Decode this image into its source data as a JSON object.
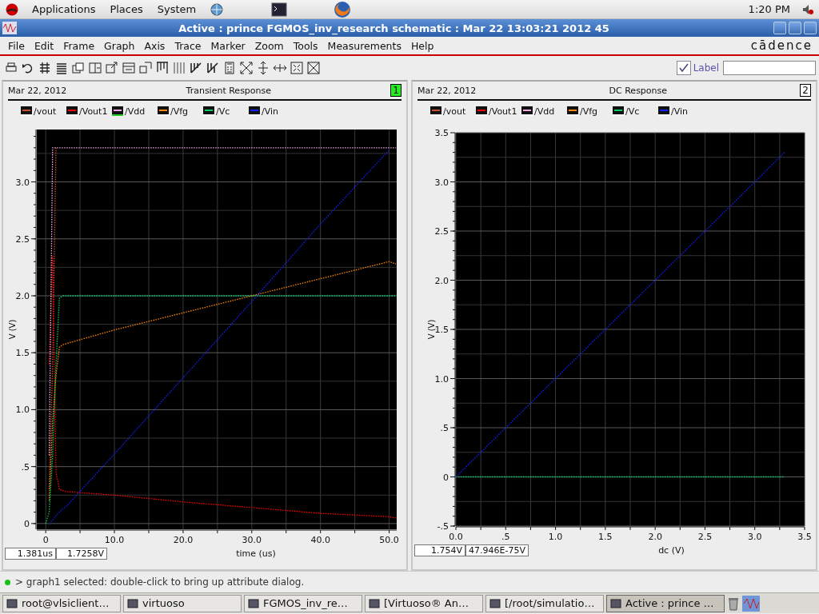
{
  "top_panel": {
    "menus": [
      "Applications",
      "Places",
      "System"
    ],
    "clock": "1:20 PM"
  },
  "window": {
    "title": "Active : prince FGMOS_inv_research schematic : Mar 22 13:03:21 2012 45",
    "menu": [
      "File",
      "Edit",
      "Frame",
      "Graph",
      "Axis",
      "Trace",
      "Marker",
      "Zoom",
      "Tools",
      "Measurements",
      "Help"
    ],
    "logo": "cādence"
  },
  "toolbar": {
    "label_checkbox": {
      "label": "Label",
      "checked": true
    }
  },
  "graphs": [
    {
      "date": "Mar 22, 2012",
      "title": "Transient Response",
      "number": "1",
      "selected": true,
      "legend": [
        {
          "selected": false
        },
        {
          "selected": false
        },
        {
          "selected": true
        },
        {
          "selected": false
        },
        {
          "selected": false
        },
        {
          "selected": false
        }
      ],
      "chart_data": {
        "type": "line",
        "grid": true,
        "xlabel": "time (us)",
        "ylabel": "V (V)",
        "x": [
          0,
          0.5,
          1,
          1.5,
          2,
          2.5,
          3,
          10,
          20,
          30,
          40,
          50,
          51
        ],
        "xlim": [
          -1.3,
          51.1
        ],
        "ylim": [
          -0.05,
          3.46
        ],
        "xticks": [
          {
            "value": 0,
            "label": "0"
          },
          {
            "value": 10,
            "label": "10.0"
          },
          {
            "value": 20,
            "label": "20.0"
          },
          {
            "value": 30,
            "label": "30.0"
          },
          {
            "value": 40,
            "label": "40.0"
          },
          {
            "value": 50,
            "label": "50.0"
          }
        ],
        "yticks": [
          {
            "value": 0,
            "label": "0"
          },
          {
            "value": 0.5,
            "label": ".5"
          },
          {
            "value": 1,
            "label": "1.0"
          },
          {
            "value": 1.5,
            "label": "1.5"
          },
          {
            "value": 2,
            "label": "2.0"
          },
          {
            "value": 2.5,
            "label": "2.5"
          },
          {
            "value": 3,
            "label": "3.0"
          }
        ],
        "series": [
          {
            "name": "/vout",
            "color": "#c8502a",
            "line_style": "dotted",
            "values": [
              null,
              0.3,
              1.4,
              3.3,
              null,
              null,
              null,
              null,
              null,
              null,
              null,
              null,
              null
            ]
          },
          {
            "name": "/Vout1",
            "color": "#ff0000",
            "line_style": "dotted",
            "values": [
              null,
              1.4,
              2.35,
              0.45,
              0.3,
              0.29,
              0.28,
              0.25,
              0.19,
              0.14,
              0.09,
              0.06,
              0.05
            ]
          },
          {
            "name": "/Vdd",
            "color": "#f4a8e8",
            "line_style": "dotted",
            "values": [
              null,
              0.6,
              3.3,
              3.3,
              3.3,
              3.3,
              3.3,
              3.3,
              3.3,
              3.3,
              3.3,
              3.3,
              3.3
            ]
          },
          {
            "name": "/Vfg",
            "color": "#ff8800",
            "line_style": "dotted",
            "values": [
              null,
              0.2,
              0.9,
              1.3,
              1.55,
              1.57,
              1.58,
              1.7,
              1.85,
              2.0,
              2.15,
              2.3,
              2.28
            ]
          },
          {
            "name": "/Vc",
            "color": "#00d060",
            "line_style": "dotted",
            "values": [
              0,
              0.1,
              0.6,
              1.4,
              1.98,
              2.0,
              2.0,
              2.0,
              2.0,
              2.0,
              2.0,
              2.0,
              2.0
            ]
          },
          {
            "name": "/Vin",
            "color": "#1020ff",
            "line_style": "dotted",
            "values": [
              null,
              0,
              0.03,
              0.07,
              0.1,
              0.13,
              0.15,
              0.61,
              1.28,
              1.95,
              2.63,
              3.28,
              null
            ]
          }
        ]
      },
      "readouts": [
        "1.381us",
        "1.7258V"
      ]
    },
    {
      "date": "Mar 22, 2012",
      "title": "DC Response",
      "number": "2",
      "selected": false,
      "legend": [
        {
          "selected": false
        },
        {
          "selected": false
        },
        {
          "selected": false
        },
        {
          "selected": false
        },
        {
          "selected": false
        },
        {
          "selected": false
        }
      ],
      "chart_data": {
        "type": "line",
        "grid": true,
        "xlabel": "dc (V)",
        "ylabel": "V (V)",
        "x": [
          0,
          3.3
        ],
        "xlim": [
          0,
          3.5
        ],
        "ylim": [
          -0.5,
          3.5
        ],
        "xticks": [
          {
            "value": 0,
            "label": "0.0"
          },
          {
            "value": 0.5,
            "label": ".5"
          },
          {
            "value": 1,
            "label": "1.0"
          },
          {
            "value": 1.5,
            "label": "1.5"
          },
          {
            "value": 2,
            "label": "2.0"
          },
          {
            "value": 2.5,
            "label": "2.5"
          },
          {
            "value": 3,
            "label": "3.0"
          },
          {
            "value": 3.5,
            "label": "3.5"
          }
        ],
        "yticks": [
          {
            "value": -0.5,
            "label": "-.5"
          },
          {
            "value": 0,
            "label": "0"
          },
          {
            "value": 0.5,
            "label": ".5"
          },
          {
            "value": 1,
            "label": "1.0"
          },
          {
            "value": 1.5,
            "label": "1.5"
          },
          {
            "value": 2,
            "label": "2.0"
          },
          {
            "value": 2.5,
            "label": "2.5"
          },
          {
            "value": 3,
            "label": "3.0"
          },
          {
            "value": 3.5,
            "label": "3.5"
          }
        ],
        "series": [
          {
            "name": "/vout",
            "color": "#c8502a",
            "line_style": "dotted",
            "values": [
              null,
              null
            ]
          },
          {
            "name": "/Vout1",
            "color": "#ff0000",
            "line_style": "dotted",
            "values": [
              null,
              null
            ]
          },
          {
            "name": "/Vdd",
            "color": "#f4a8e8",
            "line_style": "dotted",
            "values": [
              null,
              null
            ]
          },
          {
            "name": "/Vfg",
            "color": "#ff8800",
            "line_style": "dotted",
            "values": [
              null,
              null
            ]
          },
          {
            "name": "/Vc",
            "color": "#00d060",
            "line_style": "dotted",
            "values": [
              0,
              0
            ]
          },
          {
            "name": "/Vin",
            "color": "#1020ff",
            "line_style": "dotted",
            "values": [
              0,
              3.3
            ]
          }
        ]
      },
      "readouts": [
        "1.754V",
        "47.946E-75V"
      ]
    }
  ],
  "status_bar": {
    "message": "> graph1 selected: double-click to bring up attribute dialog."
  },
  "taskbar": {
    "items": [
      {
        "label": "root@vlsiclient…",
        "selected": false
      },
      {
        "label": "virtuoso",
        "selected": false
      },
      {
        "label": "FGMOS_inv_re…",
        "selected": false
      },
      {
        "label": "[Virtuoso® An…",
        "selected": false
      },
      {
        "label": "[/root/simulatio…",
        "selected": false
      },
      {
        "label": "Active : prince …",
        "selected": true
      }
    ]
  }
}
